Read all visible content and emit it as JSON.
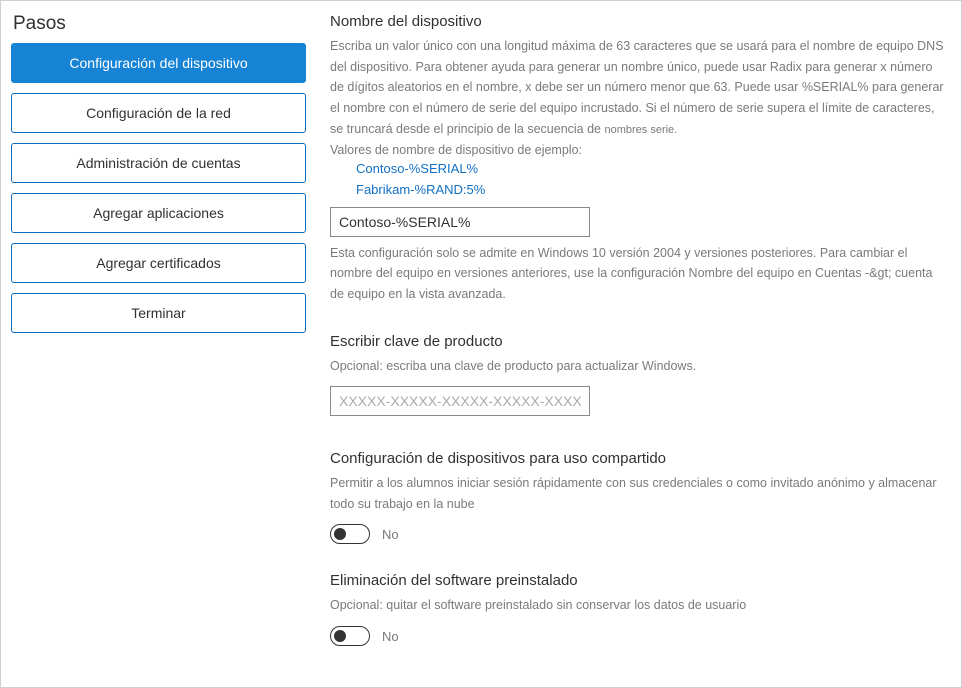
{
  "sidebar": {
    "title": "Pasos",
    "steps": [
      {
        "label": "Configuración del dispositivo",
        "active": true
      },
      {
        "label": "Configuración de la red",
        "active": false
      },
      {
        "label": "Administración de cuentas",
        "active": false
      },
      {
        "label": "Agregar aplicaciones",
        "active": false
      },
      {
        "label": "Agregar certificados",
        "active": false
      },
      {
        "label": "Terminar",
        "active": false
      }
    ]
  },
  "deviceName": {
    "title": "Nombre del dispositivo",
    "desc_a": "Escriba un valor único con una longitud máxima de 63 caracteres que se usará para el nombre de equipo DNS del dispositivo. Para obtener ayuda para generar un nombre único, puede usar Radix para generar x número de dígitos aleatorios en el nombre, x debe ser un número menor que 63. Puede usar %SERIAL% para generar el nombre con el número de serie del equipo incrustado. Si el número de serie supera el límite de caracteres, se truncará desde el principio de la secuencia de ",
    "desc_b": "nombres serie.",
    "exampleLabel": "Valores de nombre de dispositivo de ejemplo:",
    "example1": "Contoso-%SERIAL%",
    "example2": "Fabrikam-%RAND:5%",
    "inputValue": "Contoso-%SERIAL%",
    "footnote": "Esta configuración solo se admite en Windows 10 versión 2004 y versiones posteriores. Para cambiar el nombre del equipo en versiones anteriores, use la configuración Nombre del equipo en Cuentas -&gt; cuenta de equipo en la vista avanzada."
  },
  "productKey": {
    "title": "Escribir clave de producto",
    "desc": "Opcional: escriba una clave de producto para actualizar Windows.",
    "placeholder": "XXXXX-XXXXX-XXXXX-XXXXX-XXXXX",
    "value": ""
  },
  "sharedUse": {
    "title": "Configuración de dispositivos para uso compartido",
    "desc": "Permitir a los alumnos iniciar sesión rápidamente con sus credenciales o como invitado anónimo y almacenar todo su trabajo en la nube",
    "toggleLabel": "No"
  },
  "removePreinstalled": {
    "title": "Eliminación del software preinstalado",
    "desc": "Opcional: quitar el software preinstalado sin conservar los datos de usuario",
    "toggleLabel": "No"
  }
}
